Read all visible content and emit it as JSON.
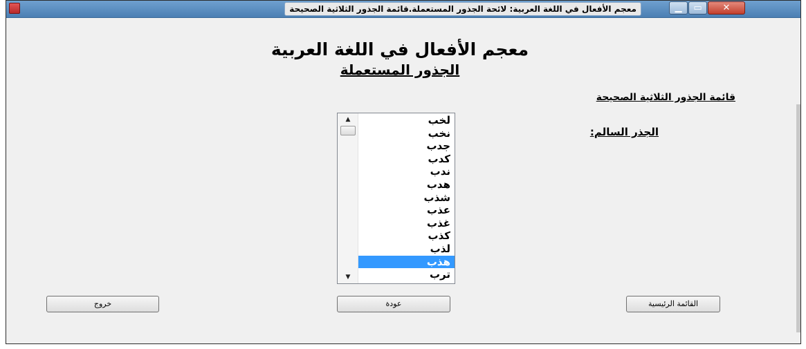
{
  "window": {
    "title": "معجم الأفعال في اللغة العربية: لائحة الجذور المستعملة.قائمة الجذور الثلاثية الصحيحة",
    "controls": {
      "minimize": "▁",
      "maximize": "▭",
      "close": "✕"
    }
  },
  "header": {
    "title": "معجم الأفعال في اللغة العربية",
    "subtitle": "الجذور المستعملة"
  },
  "list_heading": "قائمة الجذور الثلاثية الصحيحة",
  "section_label": "الجذر السالم:",
  "roots_list": {
    "items": [
      "لخب",
      "نخب",
      "جدب",
      "كدب",
      "ندب",
      "هدب",
      "شذب",
      "عذب",
      "غذب",
      "كذب",
      "لذب",
      "هذب",
      "ترب"
    ],
    "selected_index": 11
  },
  "buttons": {
    "exit": "خروج",
    "back": "عودة",
    "main_menu": "القائمة الرئيسية"
  },
  "icons": {
    "scroll_up": "▲",
    "scroll_down": "▼"
  },
  "colors": {
    "selection": "#3399ff",
    "titlebar": "#4b7fb3"
  }
}
